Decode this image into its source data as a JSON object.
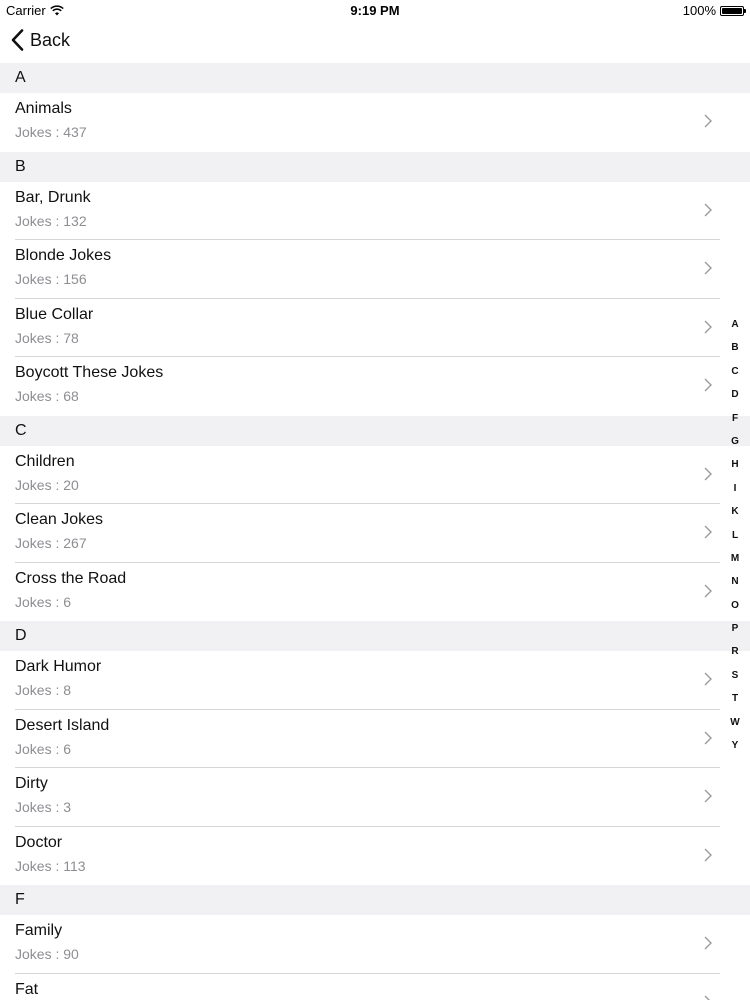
{
  "status_bar": {
    "carrier": "Carrier",
    "time": "9:19 PM",
    "battery_text": "100%",
    "battery_level": 1.0
  },
  "nav": {
    "back_label": "Back"
  },
  "sections": [
    {
      "letter": "A",
      "items": [
        {
          "title": "Animals",
          "subtitle": "Jokes : 437"
        }
      ]
    },
    {
      "letter": "B",
      "items": [
        {
          "title": "Bar, Drunk",
          "subtitle": "Jokes : 132"
        },
        {
          "title": "Blonde Jokes",
          "subtitle": "Jokes : 156"
        },
        {
          "title": "Blue Collar",
          "subtitle": "Jokes : 78"
        },
        {
          "title": "Boycott These Jokes",
          "subtitle": "Jokes : 68"
        }
      ]
    },
    {
      "letter": "C",
      "items": [
        {
          "title": "Children",
          "subtitle": "Jokes : 20"
        },
        {
          "title": "Clean Jokes",
          "subtitle": "Jokes : 267"
        },
        {
          "title": "Cross the Road",
          "subtitle": "Jokes : 6"
        }
      ]
    },
    {
      "letter": "D",
      "items": [
        {
          "title": "Dark Humor",
          "subtitle": "Jokes : 8"
        },
        {
          "title": "Desert Island",
          "subtitle": "Jokes : 6"
        },
        {
          "title": "Dirty",
          "subtitle": "Jokes : 3"
        },
        {
          "title": "Doctor",
          "subtitle": "Jokes : 113"
        }
      ]
    },
    {
      "letter": "F",
      "items": [
        {
          "title": "Family",
          "subtitle": "Jokes : 90"
        },
        {
          "title": "Fat",
          "subtitle": ""
        }
      ]
    }
  ],
  "index_letters": [
    "A",
    "B",
    "C",
    "D",
    "F",
    "G",
    "H",
    "I",
    "K",
    "L",
    "M",
    "N",
    "O",
    "P",
    "R",
    "S",
    "T",
    "W",
    "Y"
  ],
  "colors": {
    "section_bg": "#f1f1f4",
    "subtitle": "#8e8e93",
    "separator": "#d6d6d6"
  },
  "icons": {
    "back": "chevron-left-icon",
    "row": "chevron-right-icon",
    "wifi": "wifi-icon",
    "battery": "battery-icon"
  }
}
